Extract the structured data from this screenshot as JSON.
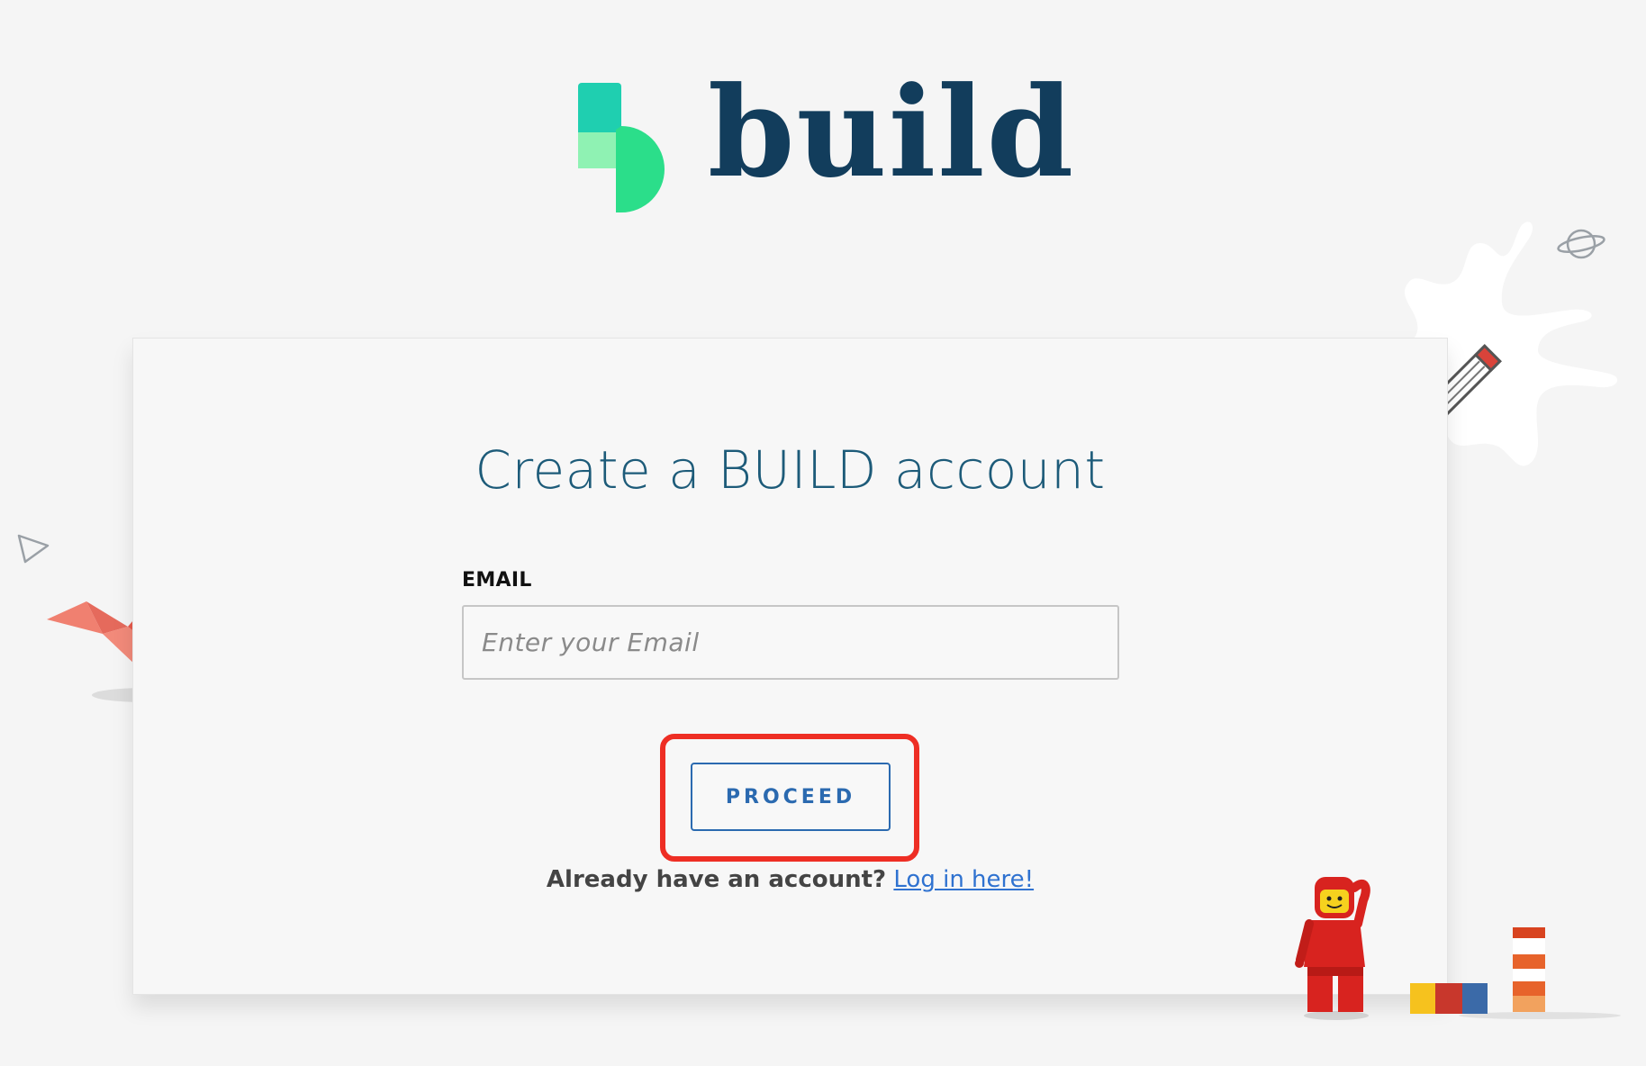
{
  "brand": {
    "name": "build",
    "colors": {
      "dark": "#123d5c",
      "teal": "#1fcfb0",
      "green": "#2bde8a",
      "mint": "#8ff2b3"
    }
  },
  "form": {
    "title": "Create a BUILD account",
    "email_label": "EMAIL",
    "email_placeholder": "Enter your Email",
    "email_value": "",
    "submit_label": "PROCEED",
    "login_prompt": "Already have an account?",
    "login_link": "Log in here!"
  },
  "annotations": {
    "arrow_color": "#ee2e24",
    "highlight_color": "#ee2e24"
  },
  "icons": {
    "logo_mark": "build-logo-mark-icon",
    "origami_bird": "origami-bird-icon",
    "triangle_outline": "triangle-outline-icon",
    "pencil": "pencil-icon",
    "planet": "planet-icon",
    "lego_figure": "lego-astronaut-icon",
    "lego_bricks": "lego-bricks-icon"
  }
}
